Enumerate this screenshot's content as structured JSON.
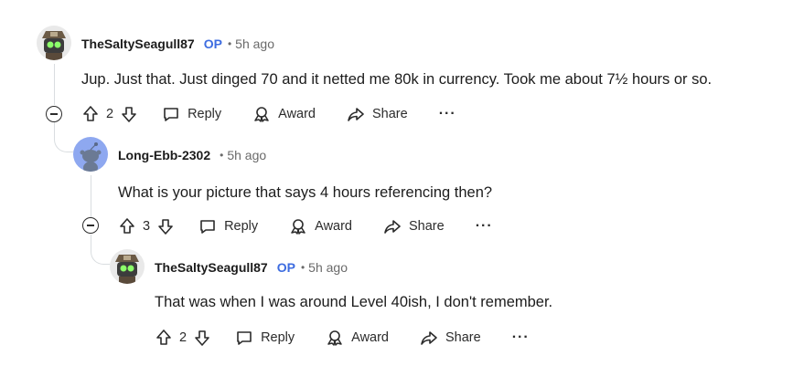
{
  "comments": [
    {
      "username": "TheSaltySeagull87",
      "op_badge": "OP",
      "time": "5h ago",
      "body": "Jup. Just that. Just dinged 70 and it netted me 80k in currency. Took me about 7½ hours or so.",
      "votes": "2",
      "avatar_icon": "pirate-robot-avatar"
    },
    {
      "username": "Long-Ebb-2302",
      "op_badge": "",
      "time": "5h ago",
      "body": "What is your picture that says 4 hours referencing then?",
      "votes": "3",
      "avatar_icon": "default-snoo-avatar"
    },
    {
      "username": "TheSaltySeagull87",
      "op_badge": "OP",
      "time": "5h ago",
      "body": "That was when I was around Level 40ish, I don't remember.",
      "votes": "2",
      "avatar_icon": "pirate-robot-avatar"
    }
  ],
  "actions": {
    "reply": "Reply",
    "award": "Award",
    "share": "Share",
    "more": "···"
  },
  "colors": {
    "op_blue": "#3d6ce0",
    "thread_line": "#d9dde0",
    "default_avatar_bg": "#8ea8f0"
  }
}
